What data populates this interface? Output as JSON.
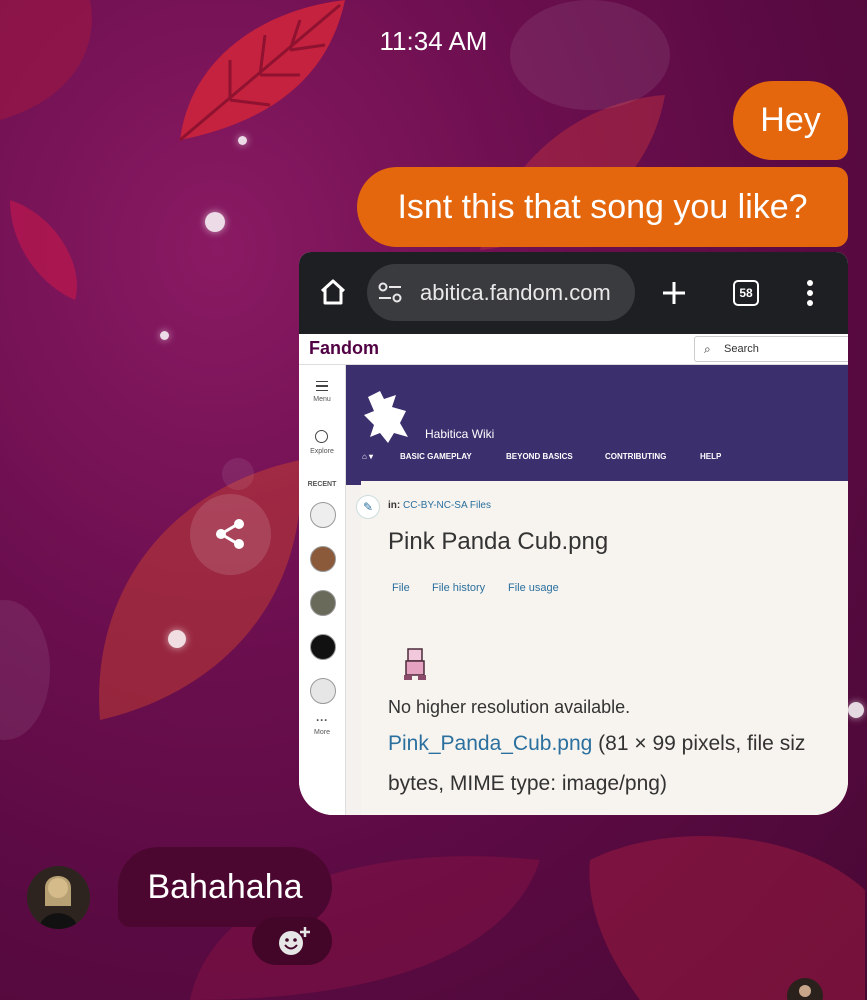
{
  "status_bar": {
    "time": "11:34 AM"
  },
  "messages_out": [
    {
      "text": "Hey"
    },
    {
      "text": "Isnt this that song you like?"
    }
  ],
  "screenshot_attachment": {
    "browser": {
      "url_text": "abitica.fandom.com",
      "tab_count": "58"
    },
    "fandom_bar": {
      "logo": "Fandom",
      "search_label": "Search"
    },
    "rail": {
      "menu": "Menu",
      "explore": "Explore",
      "recent": "RECENT",
      "more": "More"
    },
    "wiki": {
      "title": "Habitica Wiki",
      "nav": [
        "BASIC GAMEPLAY",
        "BEYOND BASICS",
        "CONTRIBUTING",
        "HELP"
      ]
    },
    "page": {
      "category_prefix": "in:",
      "category": "CC-BY-NC-SA Files",
      "title": "Pink Panda Cub.png",
      "tabs": [
        "File",
        "File history",
        "File usage"
      ],
      "no_hires": "No higher resolution available.",
      "file_link": "Pink_Panda_Cub.png",
      "file_info": " (81 × 99 pixels, file siz",
      "file_info_2": "bytes, MIME type: image/png)"
    }
  },
  "messages_in": [
    {
      "text": "Bahahaha"
    }
  ],
  "colors": {
    "outgoing_bubble": "#e4670e",
    "incoming_bubble": "#4c0731",
    "background": "#6d0f50"
  }
}
